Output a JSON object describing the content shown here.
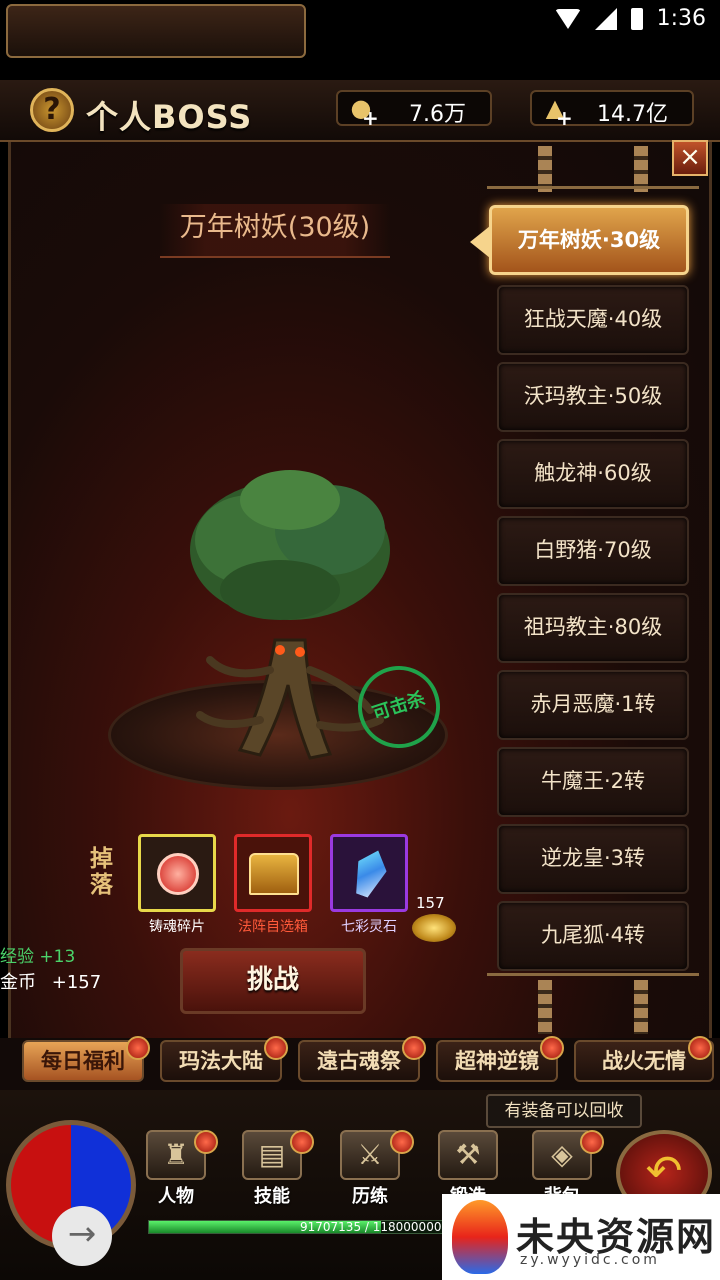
{
  "status_bar": {
    "time": "1:36"
  },
  "header": {
    "help_icon": "?",
    "title": "个人BOSS",
    "copper": "7.6万",
    "gold_ingot": "14.7亿",
    "close_icon": "×"
  },
  "boss": {
    "name": "万年树妖(30级)",
    "stamp": "可击杀"
  },
  "boss_list": [
    {
      "label": "万年树妖·30级",
      "active": true
    },
    {
      "label": "狂战天魔·40级",
      "active": false
    },
    {
      "label": "沃玛教主·50级",
      "active": false
    },
    {
      "label": "触龙神·60级",
      "active": false
    },
    {
      "label": "白野猪·70级",
      "active": false
    },
    {
      "label": "祖玛教主·80级",
      "active": false
    },
    {
      "label": "赤月恶魔·1转",
      "active": false
    },
    {
      "label": "牛魔王·2转",
      "active": false
    },
    {
      "label": "逆龙皇·3转",
      "active": false
    },
    {
      "label": "九尾狐·4转",
      "active": false
    }
  ],
  "drops": {
    "label": "掉落",
    "items": [
      {
        "name": "铸魂碎片",
        "color": "#e8d84a"
      },
      {
        "name": "法阵自选箱",
        "color": "#e02a2a"
      },
      {
        "name": "七彩灵石",
        "color": "#9a3ae0"
      }
    ],
    "gold_amount": "157"
  },
  "rewards": {
    "exp": "经验 +13",
    "coin_label": "金币",
    "coin_value": "+157"
  },
  "challenge_button": "挑战",
  "tabs": [
    {
      "label": "每日福利",
      "active": true
    },
    {
      "label": "玛法大陆",
      "active": false
    },
    {
      "label": "遠古魂祭",
      "active": false
    },
    {
      "label": "超神逆镜",
      "active": false
    },
    {
      "label": "战火无情",
      "active": false
    }
  ],
  "recycle_notice": "有装备可以回收",
  "nav": [
    {
      "label": "人物",
      "icon": "character-icon"
    },
    {
      "label": "技能",
      "icon": "skill-book-icon"
    },
    {
      "label": "历练",
      "icon": "training-icon"
    },
    {
      "label": "锻造",
      "icon": "forge-icon"
    },
    {
      "label": "背包",
      "icon": "bag-icon"
    }
  ],
  "exp_bar": {
    "text": "91707135 / 118000000",
    "fraction": 0.777
  },
  "watermark": {
    "title": "未央资源网",
    "sub": "zy.wyyidc.com"
  }
}
